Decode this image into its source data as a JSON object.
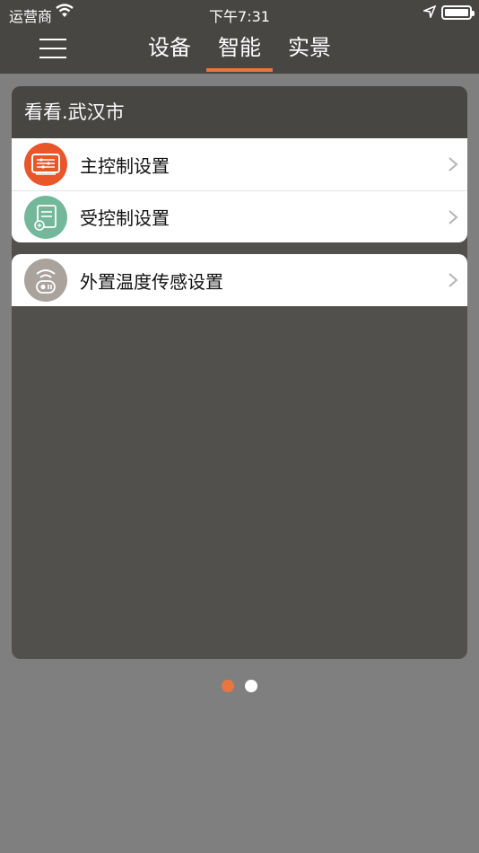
{
  "status_bar": {
    "carrier": "运营商",
    "time": "下午7:31"
  },
  "nav": {
    "tabs": [
      {
        "label": "设备",
        "active": false
      },
      {
        "label": "智能",
        "active": true
      },
      {
        "label": "实景",
        "active": false
      }
    ]
  },
  "card": {
    "title": "看看.武汉市",
    "items": [
      {
        "label": "主控制设置",
        "icon": "sliders-panel-icon",
        "color": "#e8562a"
      },
      {
        "label": "受控制设置",
        "icon": "receiver-device-icon",
        "color": "#73b89b"
      },
      {
        "label": "外置温度传感设置",
        "icon": "wifi-sensor-icon",
        "color": "#aaa39d"
      }
    ]
  },
  "pagination": {
    "pages": 2,
    "current": 1,
    "active_color": "#e9753f",
    "inactive_color": "#ffffff"
  },
  "colors": {
    "bar": "#474643",
    "background": "#7f7f7f",
    "accent": "#e9753f"
  }
}
